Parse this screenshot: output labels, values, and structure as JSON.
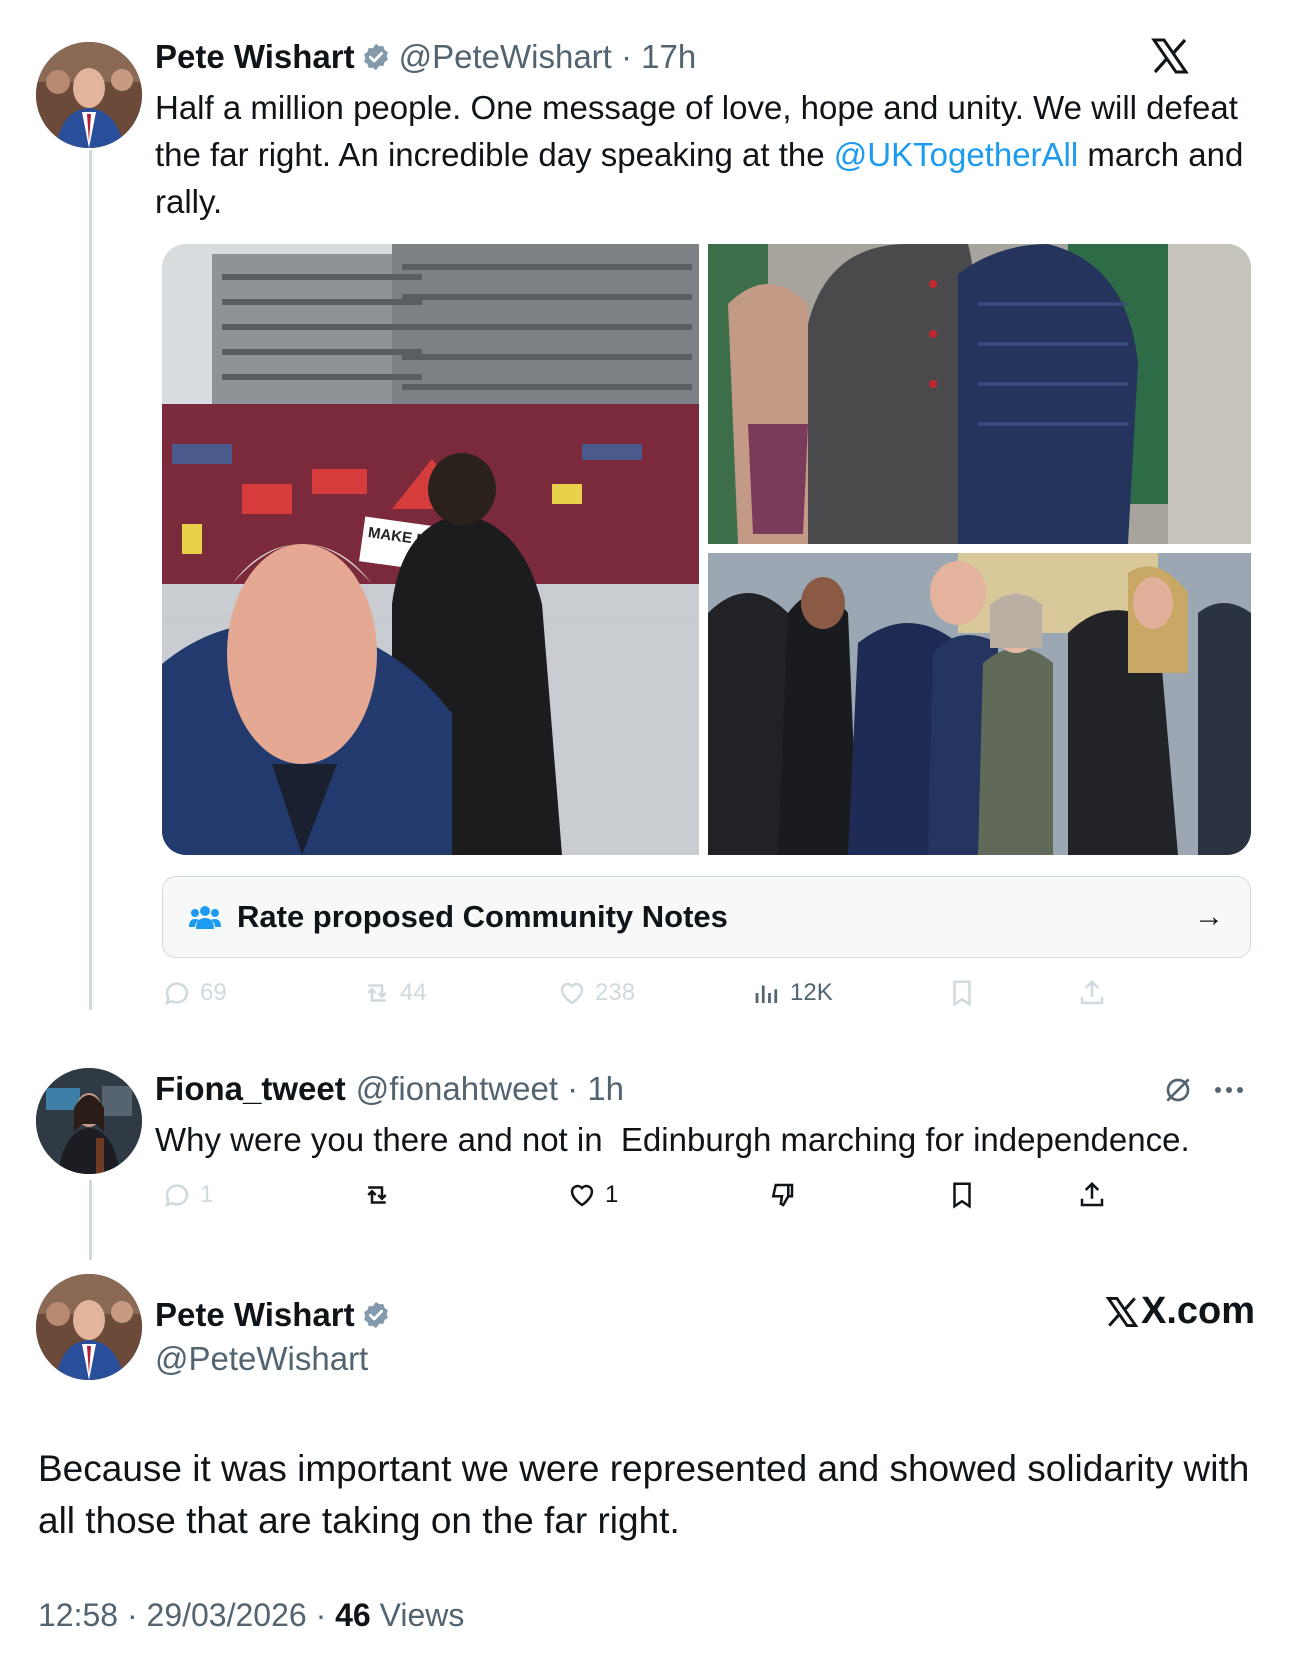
{
  "tweet1": {
    "name": "Pete Wishart",
    "handle": "@PeteWishart",
    "time": "17h",
    "text_before": "Half a million people. One message of love, hope and unity. We will defeat the far right. An incredible day speaking at the ",
    "mention": "@UKTogetherAll",
    "text_after": " march and rally.",
    "banner_text": "MAKE NAZIS",
    "community_notes_label": "Rate proposed Community Notes",
    "stats": {
      "replies": "69",
      "reposts": "44",
      "likes": "238",
      "views": "12K"
    }
  },
  "tweet2": {
    "name": "Fiona_tweet",
    "handle": "@fionahtweet",
    "time": "1h",
    "text": "Why were you there and not in  Edinburgh marching for independence.",
    "stats": {
      "replies": "1",
      "likes": "1"
    }
  },
  "tweet3": {
    "name": "Pete Wishart",
    "handle": "@PeteWishart",
    "brand": "X.com",
    "text": "Because it was important we were represented and showed solidarity with all those that are taking on the far right.",
    "time": "12:58",
    "date": "29/03/2026",
    "views_count": "46",
    "views_label": "Views"
  },
  "colors": {
    "accent": "#1d9bf0",
    "text": "#0f1419",
    "muted": "#536471",
    "border": "#cfd9de"
  },
  "icons": [
    "verified-badge-icon",
    "x-logo-icon",
    "community-notes-icon",
    "reply-icon",
    "repost-icon",
    "like-icon",
    "views-icon",
    "bookmark-icon",
    "share-icon",
    "grok-icon",
    "more-icon",
    "dislike-icon"
  ]
}
